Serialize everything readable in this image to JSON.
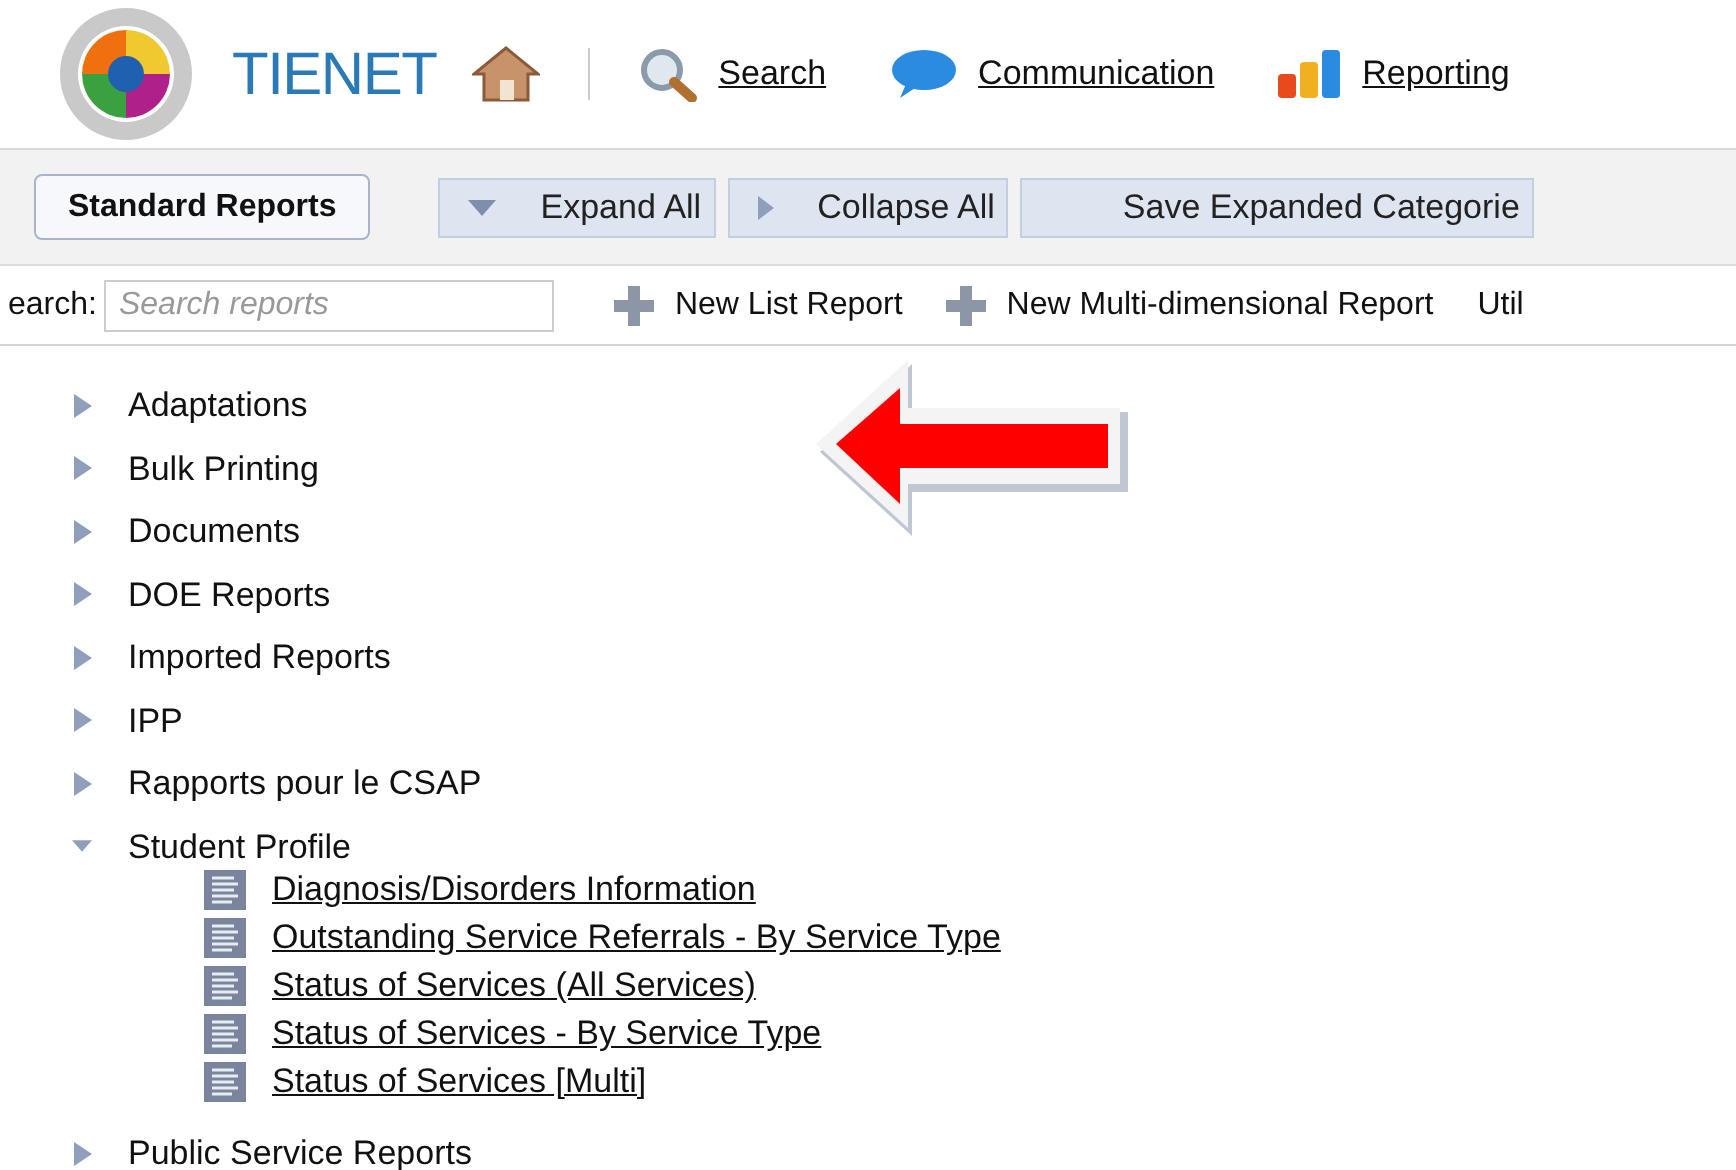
{
  "header": {
    "logo_text": "TIENET",
    "nav": [
      {
        "label": "Search",
        "kind": "search"
      },
      {
        "label": "Communication",
        "kind": "chat"
      },
      {
        "label": "Reporting",
        "kind": "chart"
      }
    ]
  },
  "toolbar": {
    "tab": "Standard Reports",
    "buttons": [
      {
        "label": "Expand All",
        "kind": "expand"
      },
      {
        "label": "Collapse All",
        "kind": "collapse"
      },
      {
        "label": "Save Expanded Categorie",
        "kind": "plain"
      }
    ]
  },
  "actions": {
    "search_label": "earch:",
    "search_placeholder": "Search reports",
    "items": [
      {
        "label": "New List Report",
        "kind": "add"
      },
      {
        "label": "New Multi-dimensional Report",
        "kind": "add"
      },
      {
        "label": "Util",
        "kind": "plain"
      }
    ]
  },
  "tree": [
    {
      "label": "Adaptations",
      "expanded": false
    },
    {
      "label": "Bulk Printing",
      "expanded": false
    },
    {
      "label": "Documents",
      "expanded": false
    },
    {
      "label": "DOE Reports",
      "expanded": false
    },
    {
      "label": "Imported Reports",
      "expanded": false
    },
    {
      "label": "IPP",
      "expanded": false
    },
    {
      "label": "Rapports pour le CSAP",
      "expanded": false
    },
    {
      "label": "Student Profile",
      "expanded": true,
      "children": [
        {
          "label": "Diagnosis/Disorders Information"
        },
        {
          "label": "Outstanding Service Referrals - By Service Type"
        },
        {
          "label": "Status of Services (All Services)"
        },
        {
          "label": "Status of Services - By Service Type"
        },
        {
          "label": "Status of Services [Multi]"
        }
      ]
    },
    {
      "label": "Public Service Reports",
      "expanded": false
    }
  ]
}
